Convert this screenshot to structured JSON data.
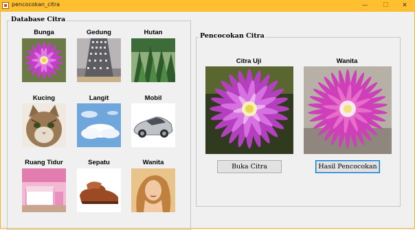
{
  "window": {
    "title": "pencocokan_citra",
    "minimize_glyph": "—",
    "maximize_glyph": "☐",
    "close_glyph": "✕"
  },
  "database": {
    "title": "Database Citra",
    "items": [
      {
        "label": "Bunga"
      },
      {
        "label": "Gedung"
      },
      {
        "label": "Hutan"
      },
      {
        "label": "Kucing"
      },
      {
        "label": "Langit"
      },
      {
        "label": "Mobil"
      },
      {
        "label": "Ruang Tidur"
      },
      {
        "label": "Sepatu"
      },
      {
        "label": "Wanita"
      }
    ]
  },
  "matching": {
    "title": "Pencocokan Citra",
    "query_label": "Citra Uji",
    "result_label": "Wanita",
    "open_button": "Buka Citra",
    "match_button": "Hasil Pencocokan"
  },
  "colors": {
    "titlebar": "#ffbf2e",
    "window_bg": "#f0f0f0",
    "flower_pink": "#d04fd8",
    "focus_blue": "#0078d7"
  }
}
